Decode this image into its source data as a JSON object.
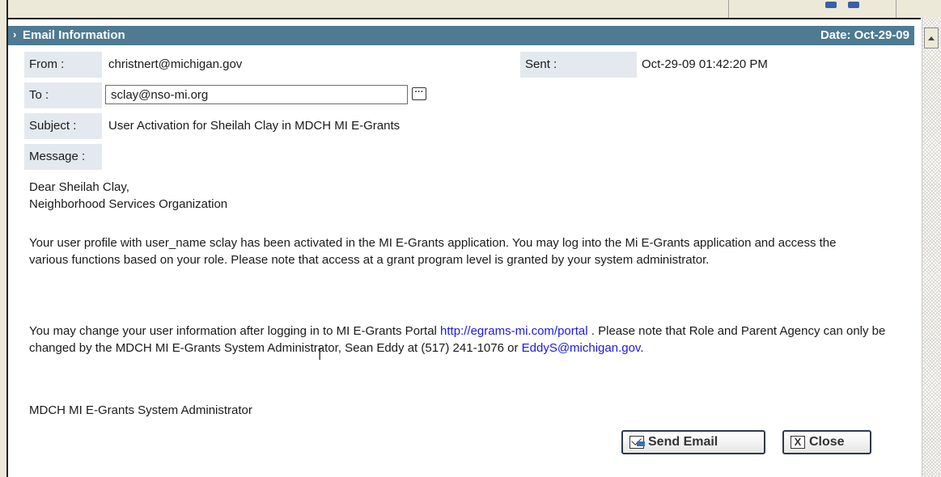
{
  "header": {
    "title": "Email Information",
    "date": "Date: Oct-29-09",
    "icon": "expand-arrow-icon"
  },
  "fields": {
    "from_label": "From :",
    "from_value": "christnert@michigan.gov",
    "sent_label": "Sent :",
    "sent_value": "Oct-29-09 01:42:20 PM",
    "to_label": "To :",
    "to_value": "sclay@nso-mi.org",
    "lookup_label": "···",
    "subject_label": "Subject :",
    "subject_value": "User Activation for Sheilah Clay in MDCH MI E-Grants",
    "message_label": "Message :"
  },
  "message": {
    "greeting_line1": "Dear Sheilah Clay,",
    "greeting_line2": "Neighborhood Services Organization",
    "paragraph1": "Your user profile with user_name sclay has been activated in the MI E-Grants application. You may log into the Mi E-Grants application and access the various functions based on your role. Please note that access at a grant program level is granted by your system administrator.",
    "paragraph2_before_link": "You may change your user information after logging in to MI E-Grants Portal ",
    "portal_link": "http://egrams-mi.com/portal",
    "paragraph2_middle": " . Please note that Role and Parent Agency can only be changed by the MDCH MI E-Grants System Administrator, Sean Eddy at (517) 241-1076 or ",
    "admin_email_link": "EddyS@michigan.gov",
    "paragraph2_end": ".",
    "signature": "MDCH MI E-Grants System Administrator"
  },
  "buttons": {
    "send_label": "Send Email",
    "send_icon": "envelope-send-icon",
    "close_label": "Close",
    "close_icon": "close-x-icon",
    "close_icon_glyph": "X"
  },
  "colors": {
    "header_bg": "#4e7a92",
    "label_bg": "#e3e9ef",
    "link": "#1a1adb"
  }
}
